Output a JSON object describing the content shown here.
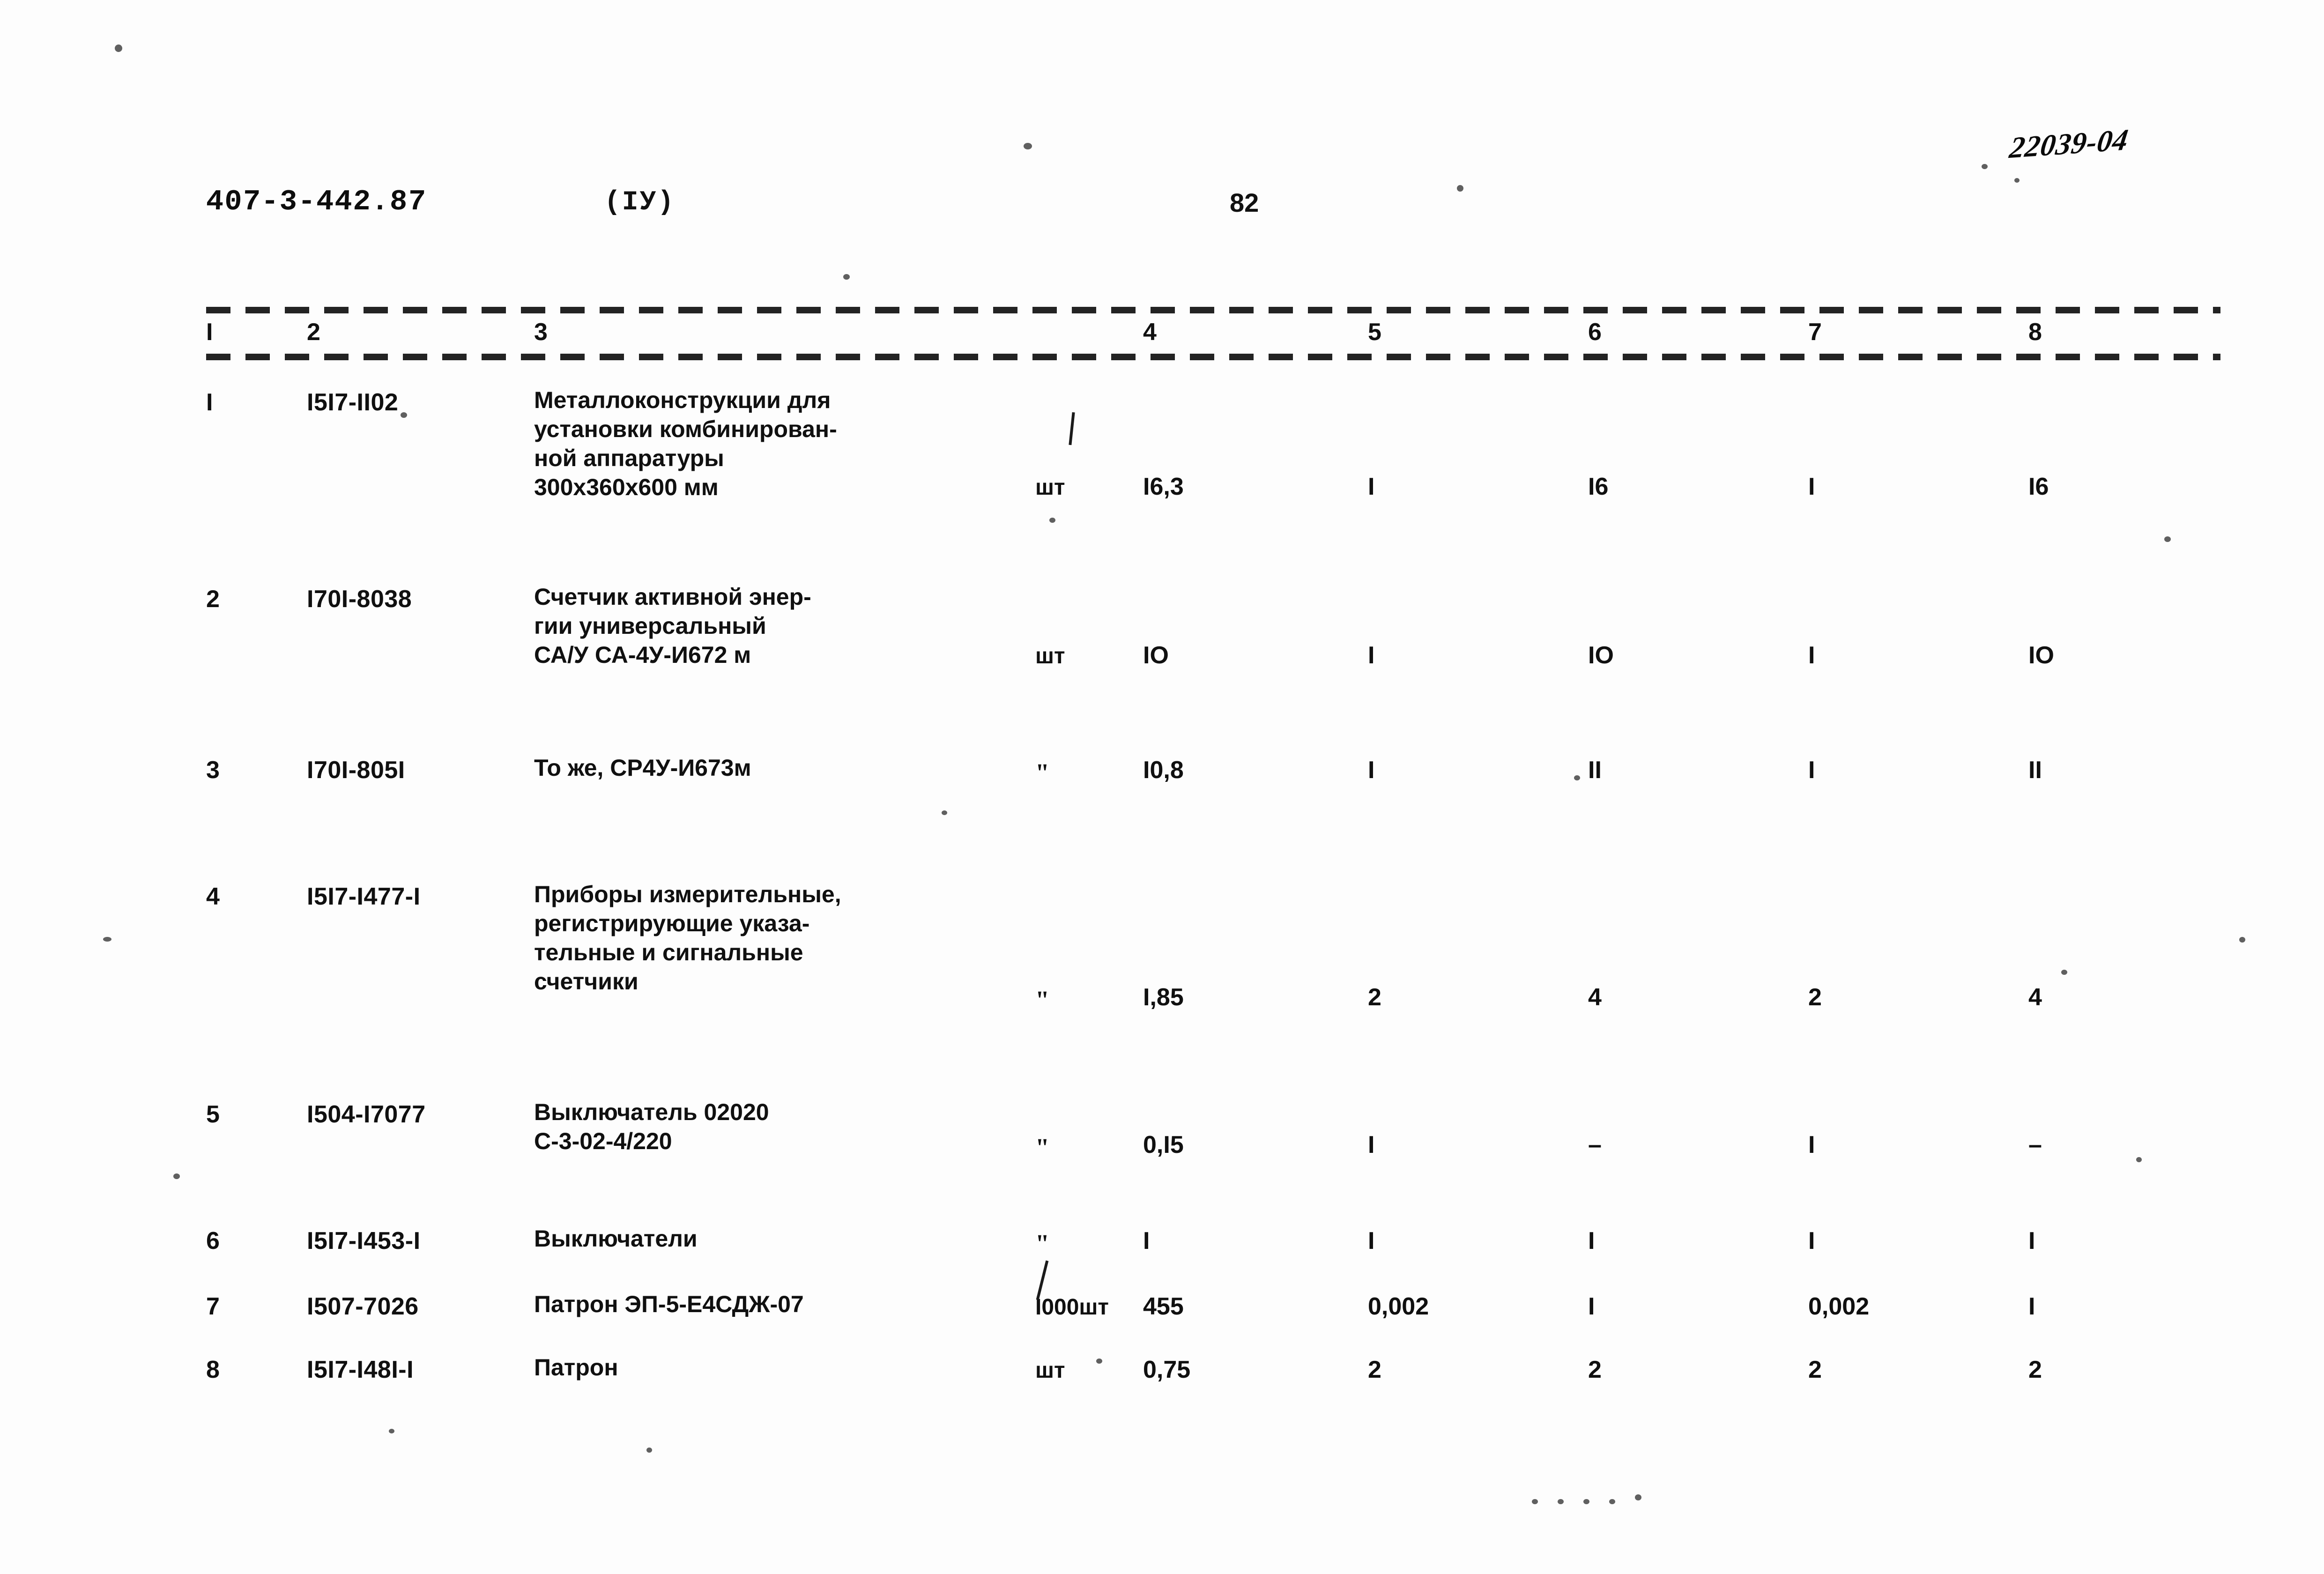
{
  "header": {
    "doc_code": "407-3-442.87",
    "variant": "(IУ)",
    "page_number": "82",
    "stamp_number": "22039-04"
  },
  "table": {
    "column_headers": [
      "I",
      "2",
      "3",
      "4",
      "5",
      "6",
      "7",
      "8"
    ],
    "rows": [
      {
        "num": "I",
        "code": "I5I7-II02",
        "name": "Металлоконструкции для\nустановки комбинирован-\nной аппаратуры\n300х360х600 мм",
        "unit": "шт",
        "c4": "I6,3",
        "c5": "I",
        "c6": "I6",
        "c7": "I",
        "c8": "I6"
      },
      {
        "num": "2",
        "code": "I70I-8038",
        "name": "Счетчик активной энер-\nгии универсальный\nСА/У СА-4У-И672 м",
        "unit": "шт",
        "c4": "IO",
        "c5": "I",
        "c6": "IO",
        "c7": "I",
        "c8": "IO"
      },
      {
        "num": "3",
        "code": "I70I-805I",
        "name": "То же, СР4У-И673м",
        "unit": "\"",
        "c4": "I0,8",
        "c5": "I",
        "c6": "II",
        "c7": "I",
        "c8": "II"
      },
      {
        "num": "4",
        "code": "I5I7-I477-I",
        "name": "Приборы измерительные,\nрегистрирующие указа-\nтельные и сигнальные\nсчетчики",
        "unit": "\"",
        "c4": "I,85",
        "c5": "2",
        "c6": "4",
        "c7": "2",
        "c8": "4"
      },
      {
        "num": "5",
        "code": "I504-I7077",
        "name": "Выключатель 02020\nС-3-02-4/220",
        "unit": "\"",
        "c4": "0,I5",
        "c5": "I",
        "c6": "–",
        "c7": "I",
        "c8": "–"
      },
      {
        "num": "6",
        "code": "I5I7-I453-I",
        "name": "Выключатели",
        "unit": "\"",
        "c4": "I",
        "c5": "I",
        "c6": "I",
        "c7": "I",
        "c8": "I"
      },
      {
        "num": "7",
        "code": "I507-7026",
        "name": "Патрон ЭП-5-Е4СДЖ-07",
        "unit": "I000шт",
        "c4": "455",
        "c5": "0,002",
        "c6": "I",
        "c7": "0,002",
        "c8": "I"
      },
      {
        "num": "8",
        "code": "I5I7-I48I-I",
        "name": "Патрон",
        "unit": "шт",
        "c4": "0,75",
        "c5": "2",
        "c6": "2",
        "c7": "2",
        "c8": "2"
      }
    ]
  }
}
